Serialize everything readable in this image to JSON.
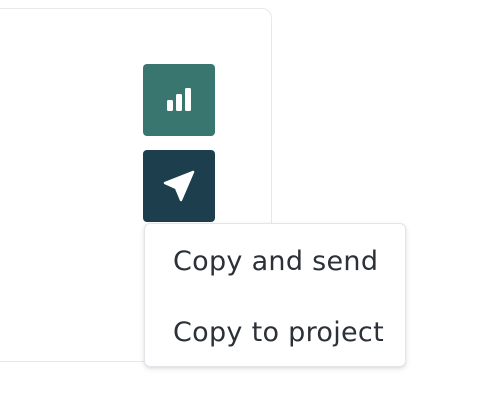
{
  "colors": {
    "stats_button_bg": "#3a7670",
    "send_button_bg": "#1d3e4d",
    "icon_color": "#ffffff",
    "menu_text": "#2b3137"
  },
  "actions": {
    "stats_button": {
      "icon": "bar-chart-icon"
    },
    "send_button": {
      "icon": "paper-plane-icon"
    }
  },
  "menu": {
    "items": [
      {
        "label": "Copy and send"
      },
      {
        "label": "Copy to project"
      }
    ]
  }
}
